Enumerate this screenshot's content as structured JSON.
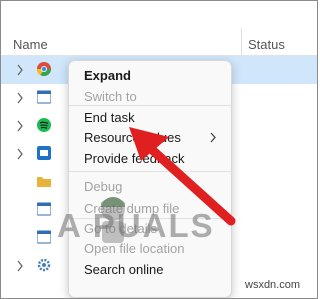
{
  "table": {
    "name_header": "Name",
    "status_header": "Status"
  },
  "rows": [
    {
      "icon": "chrome-icon",
      "color": "#dd4b39",
      "selected": true
    },
    {
      "icon": "app-window-icon",
      "color": "#2f6db5"
    },
    {
      "icon": "spotify-icon",
      "color": "#1db954"
    },
    {
      "icon": "app-tile-icon",
      "color": "#1e73c9"
    },
    {
      "icon": "folder-icon",
      "color": "#e8b33a"
    },
    {
      "icon": "app-window-icon",
      "color": "#2f6db5"
    },
    {
      "icon": "app-window-icon",
      "color": "#2f6db5"
    },
    {
      "icon": "app-window-icon",
      "color": "#2f6db5"
    },
    {
      "icon": "gear-icon",
      "color": "#4a7fb5"
    }
  ],
  "context_menu": {
    "items": [
      {
        "label": "Expand",
        "enabled": true,
        "bold": true
      },
      {
        "label": "Switch to",
        "enabled": false
      },
      {
        "label": "End task",
        "enabled": true
      },
      {
        "label": "Resource values",
        "enabled": true,
        "submenu": true
      },
      {
        "label": "Provide feedback",
        "enabled": true
      },
      {
        "label": "Debug",
        "enabled": false
      },
      {
        "label": "Create dump file",
        "enabled": false
      },
      {
        "label": "Go to details",
        "enabled": false
      },
      {
        "label": "Open file location",
        "enabled": false
      },
      {
        "label": "Search online",
        "enabled": true
      }
    ]
  },
  "watermark": {
    "text": "A  PUALS",
    "site": "wsxdn.com"
  },
  "colors": {
    "selection": "#cfe6fb",
    "arrow": "#e02020"
  }
}
